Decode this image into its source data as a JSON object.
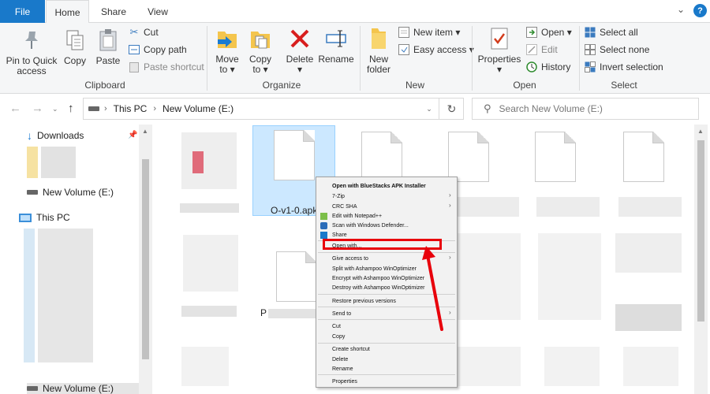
{
  "tabs": {
    "file": "File",
    "home": "Home",
    "share": "Share",
    "view": "View"
  },
  "ribbon": {
    "clipboard": {
      "group_label": "Clipboard",
      "pin_line1": "Pin to Quick",
      "pin_line2": "access",
      "copy": "Copy",
      "paste": "Paste",
      "cut": "Cut",
      "copy_path": "Copy path",
      "paste_shortcut": "Paste shortcut"
    },
    "organize": {
      "group_label": "Organize",
      "move_to_line1": "Move",
      "move_to_line2": "to ▾",
      "copy_to_line1": "Copy",
      "copy_to_line2": "to ▾",
      "delete_line1": "Delete",
      "delete_line2": "▾",
      "rename": "Rename"
    },
    "new": {
      "group_label": "New",
      "new_folder_line1": "New",
      "new_folder_line2": "folder",
      "new_item": "New item ▾",
      "easy_access": "Easy access ▾"
    },
    "open": {
      "group_label": "Open",
      "properties_line1": "Properties",
      "properties_line2": "▾",
      "open": "Open ▾",
      "edit": "Edit",
      "history": "History"
    },
    "select": {
      "group_label": "Select",
      "select_all": "Select all",
      "select_none": "Select none",
      "invert_selection": "Invert selection"
    }
  },
  "address": {
    "this_pc": "This PC",
    "volume": "New Volume (E:)",
    "search_placeholder": "Search New Volume (E:)"
  },
  "navpane": {
    "downloads": "Downloads",
    "new_volume": "New Volume (E:)",
    "this_pc": "This PC",
    "new_volume_bottom": "New Volume (E:)"
  },
  "content": {
    "selected_file": "O-v1-0.apk",
    "partial_name": "P"
  },
  "context_menu": {
    "items": [
      "Open with BlueStacks APK Installer",
      "7-Zip",
      "CRC SHA",
      "Edit with Notepad++",
      "Scan with Windows Defender...",
      "Share",
      "Open with...",
      "Give access to",
      "Split with Ashampoo WinOptimizer",
      "Encrypt with Ashampoo WinOptimizer",
      "Destroy with Ashampoo WinOptimizer",
      "Restore previous versions",
      "Send to",
      "Cut",
      "Copy",
      "Create shortcut",
      "Delete",
      "Rename",
      "Properties"
    ]
  },
  "colors": {
    "accent": "#1979ca",
    "highlight": "#e8000b",
    "selection": "#cce8ff"
  }
}
